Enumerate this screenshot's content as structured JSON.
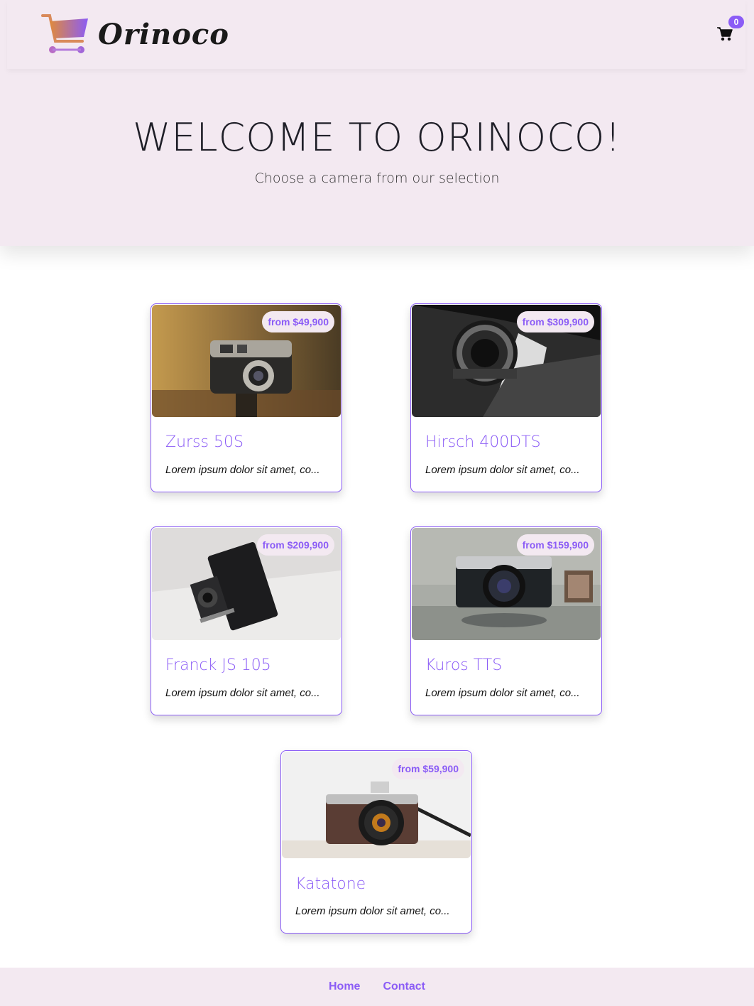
{
  "brand": {
    "name": "Orinoco",
    "logo_icon": "shopping-cart-logo-icon"
  },
  "cart": {
    "icon": "shopping-cart-icon",
    "count": "0"
  },
  "hero": {
    "title": "WELCOME TO ORINOCO!",
    "subtitle": "Choose a camera from our selection"
  },
  "products": [
    {
      "name": "Zurss 50S",
      "price": "from $49,900",
      "description": "Lorem ipsum dolor sit amet, co..."
    },
    {
      "name": "Hirsch 400DTS",
      "price": "from $309,900",
      "description": "Lorem ipsum dolor sit amet, co..."
    },
    {
      "name": "Franck JS 105",
      "price": "from $209,900",
      "description": "Lorem ipsum dolor sit amet, co..."
    },
    {
      "name": "Kuros TTS",
      "price": "from $159,900",
      "description": "Lorem ipsum dolor sit amet, co..."
    },
    {
      "name": "Katatone",
      "price": "from $59,900",
      "description": "Lorem ipsum dolor sit amet, co..."
    }
  ],
  "footer": {
    "home": "Home",
    "contact": "Contact"
  },
  "colors": {
    "accent": "#8b5cf6",
    "background": "#f3e9f1"
  }
}
